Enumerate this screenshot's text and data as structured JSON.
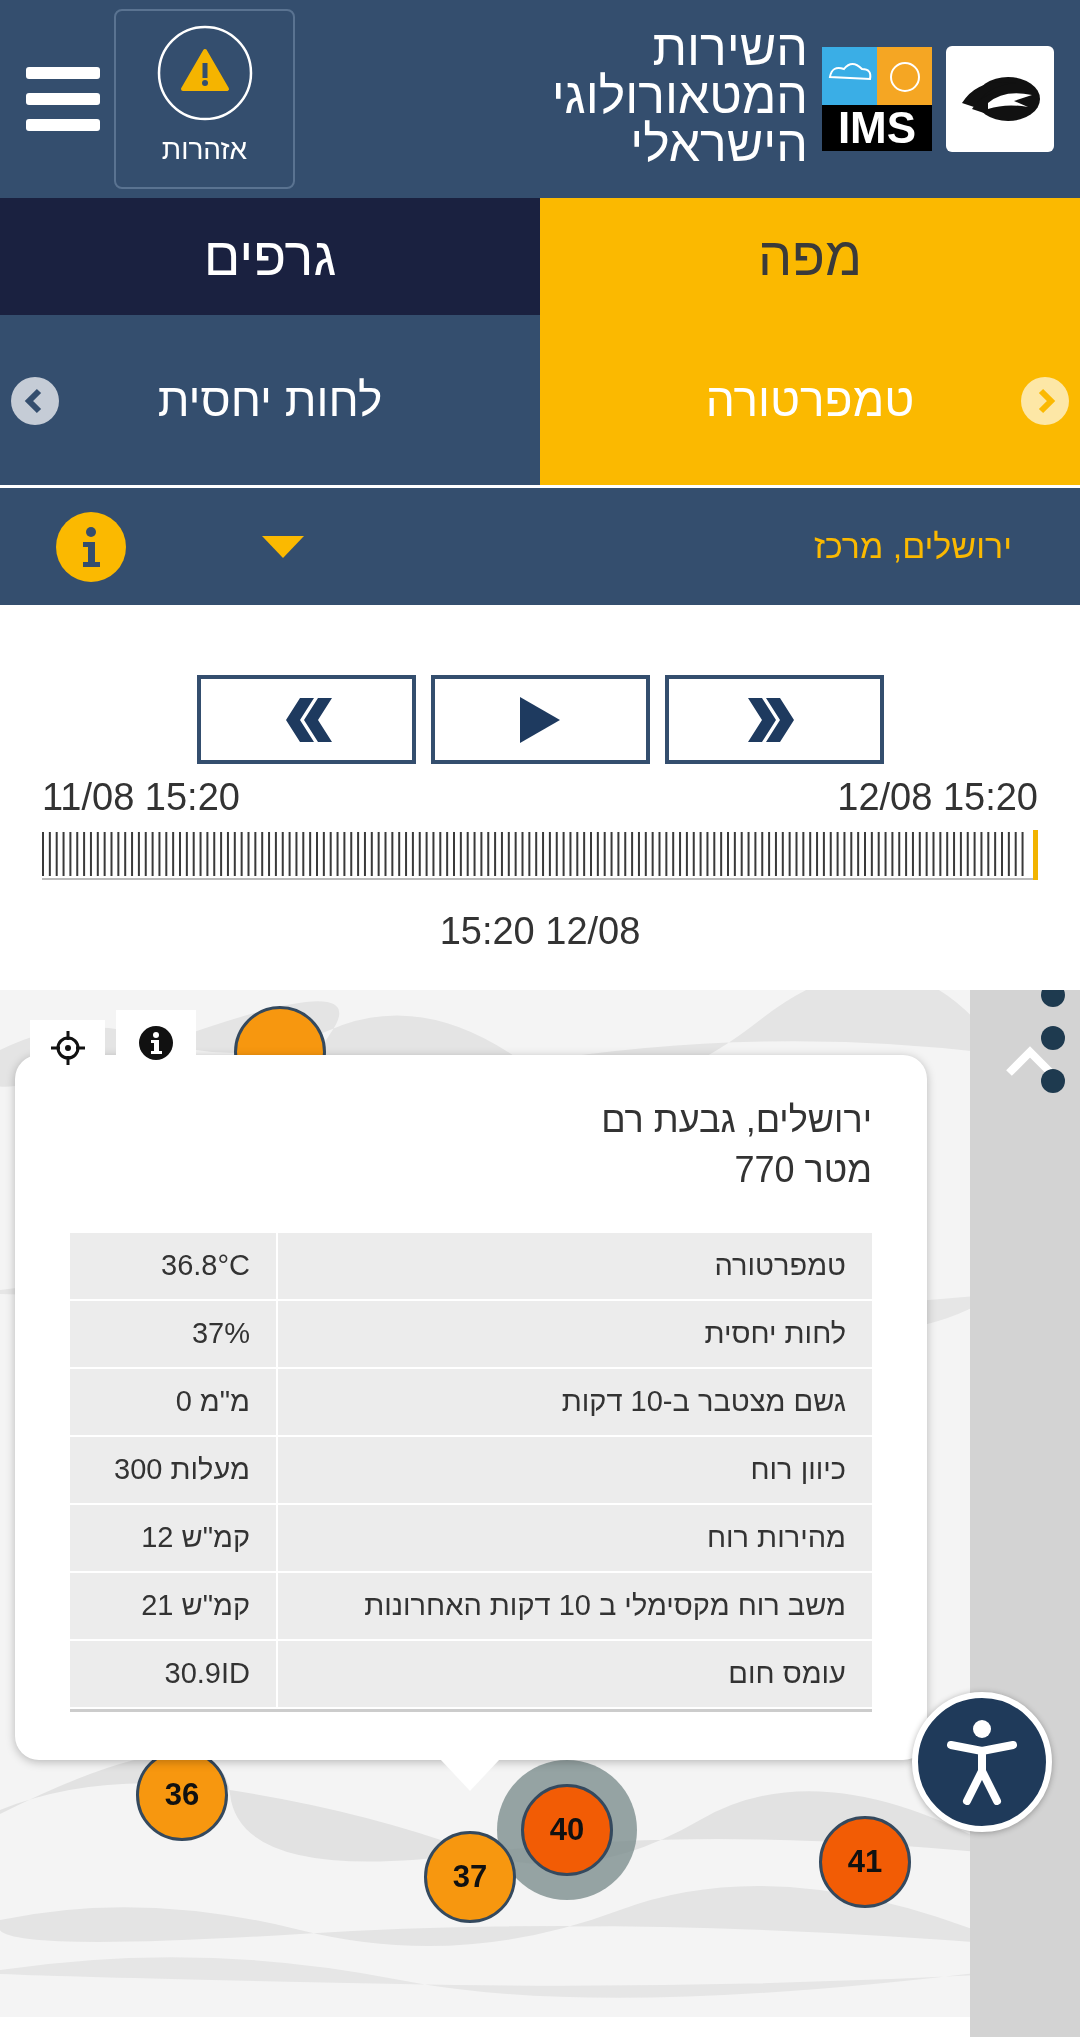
{
  "header": {
    "title_lines": [
      "השירות",
      "המטאורולוגי",
      "הישראלי"
    ],
    "logo_text": "IMS",
    "alerts_button": {
      "label": "אזהרות"
    }
  },
  "view_tabs": [
    {
      "label": "מפה",
      "selected": true
    },
    {
      "label": "גרפים",
      "selected": false
    }
  ],
  "parameter_tabs": [
    {
      "label": "טמפרטורה",
      "selected": true
    },
    {
      "label": "לחות יחסית",
      "selected": false
    }
  ],
  "region_select": {
    "value": "ירושלים, מרכז"
  },
  "player_buttons": [
    {
      "kind": "back"
    },
    {
      "kind": "play"
    },
    {
      "kind": "forward"
    }
  ],
  "timeline": {
    "start": "11/08 15:20",
    "end": "12/08 15:20",
    "level": 1,
    "current": "15:20 12/08"
  },
  "map": {
    "markers": [
      {
        "color": "#f7970f",
        "highlighted": false
      },
      {
        "label": "36",
        "color": "#f7970f",
        "highlighted": false
      },
      {
        "label": "40",
        "color": "#f25c05",
        "highlighted": true
      },
      {
        "label": "37",
        "color": "#f7970f",
        "highlighted": false
      },
      {
        "label": "41",
        "color": "#f25c05",
        "highlighted": false
      }
    ]
  },
  "popup": {
    "station": "ירושלים, גבעת רם",
    "elevation": "770 מטר",
    "rows": [
      {
        "label": "טמפרטורה",
        "value": "36.8°C"
      },
      {
        "label": "לחות יחסית",
        "value": "37%"
      },
      {
        "label": "גשם מצטבר ב-10 דקות",
        "value": "0 מ\"מ"
      },
      {
        "label": "כיוון רוח",
        "value": "300 מעלות"
      },
      {
        "label": "מהירות רוח",
        "value": "12 קמ\"ש"
      },
      {
        "label": "משב רוח מקסימלי ב 10 דקות האחרונות",
        "value": "21 קמ\"ש"
      },
      {
        "label": "עומס חום",
        "value": "30.9ID"
      }
    ]
  }
}
